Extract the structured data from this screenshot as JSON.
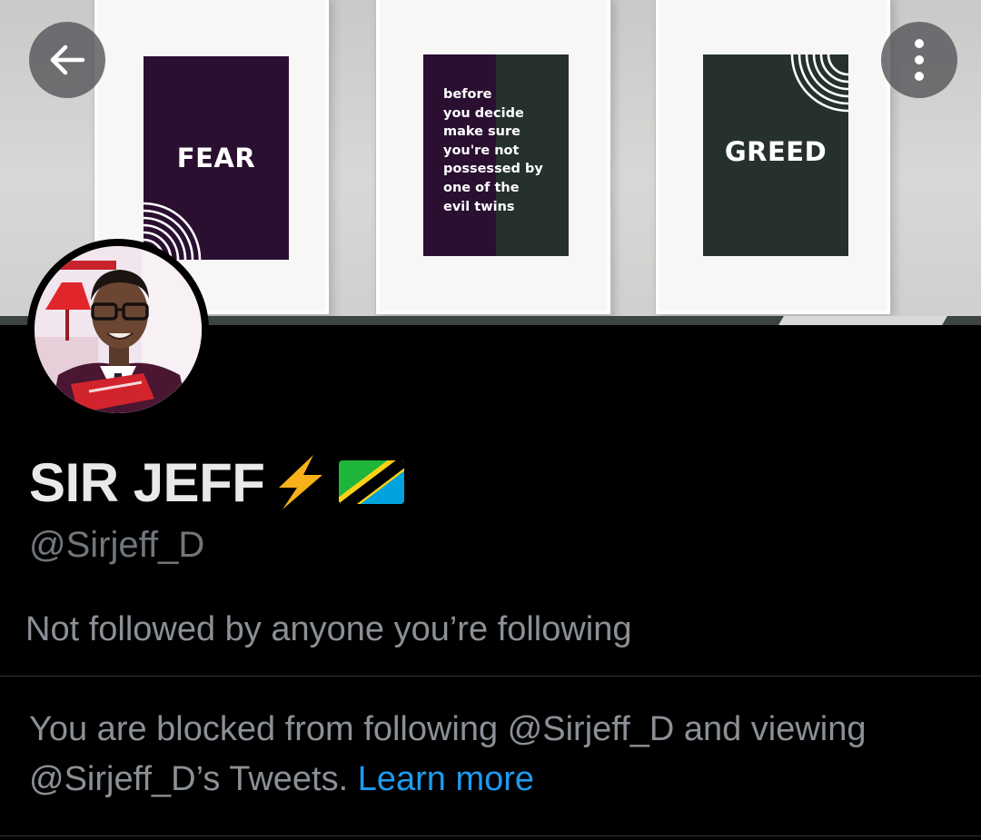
{
  "banner": {
    "posters": [
      {
        "word": "FEAR"
      },
      {
        "quote": [
          "before",
          "you decide",
          "make sure",
          "you're not",
          "possessed by",
          "one of the",
          "evil twins"
        ]
      },
      {
        "word": "GREED"
      }
    ]
  },
  "nav": {
    "back_icon": "arrow-left-icon",
    "more_icon": "more-vertical-icon"
  },
  "profile": {
    "display_name": "SIR JEFF",
    "name_emojis": [
      "lightning-bolt-emoji",
      "tanzania-flag-emoji"
    ],
    "handle": "@Sirjeff_D",
    "followers_note": "Not followed by anyone you’re following"
  },
  "blocked": {
    "message": "You are blocked from following @Sirjeff_D and viewing @Sirjeff_D’s Tweets.",
    "link_label": "Learn more"
  },
  "colors": {
    "background": "#000000",
    "primary_text": "#e7e9ea",
    "secondary_text": "#71767b",
    "link": "#1d9bf0",
    "divider": "#2f3336",
    "bolt": "#f7b21b"
  }
}
